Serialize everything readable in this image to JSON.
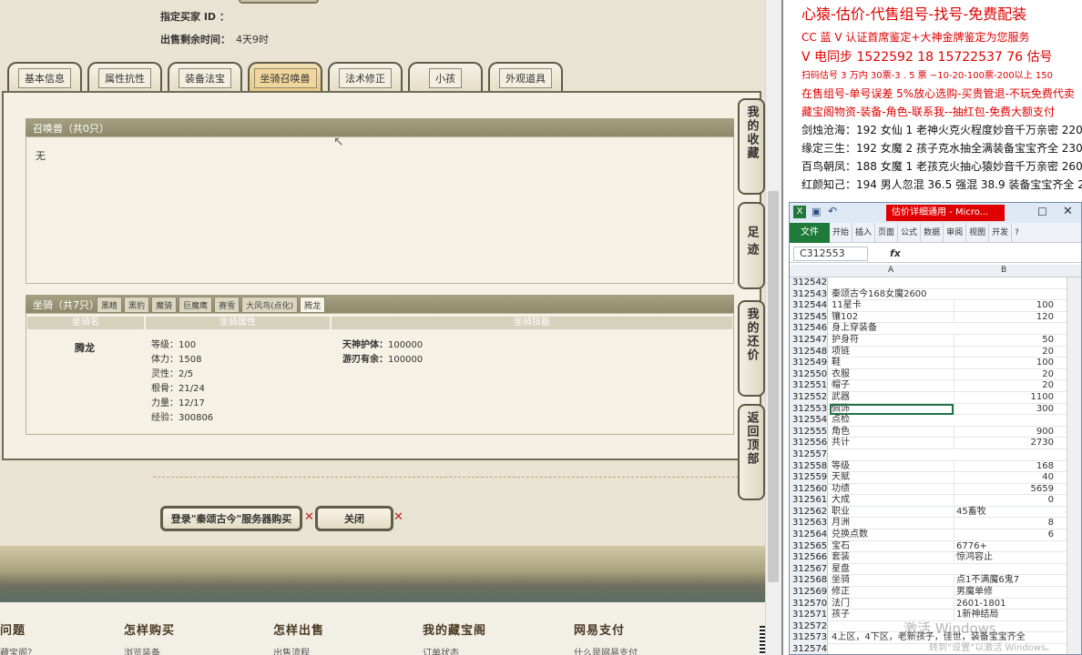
{
  "game": {
    "buyer_label": "指定买家 ID ：",
    "time_label": "出售剩余时间：",
    "time_value": "4天9时",
    "tabs": [
      "基本信息",
      "属性抗性",
      "装备法宝",
      "坐骑召唤兽",
      "法术修正",
      "小孩",
      "外观道具"
    ],
    "active_tab": "坐骑召唤兽",
    "summon_header": "召唤兽（共0只）",
    "summon_empty": "无",
    "mount_header": "坐骑（共7只）",
    "mount_tabs": [
      "黑睛",
      "黑豹",
      "魔骑",
      "巨魔鹰",
      "赛雪",
      "大风鸟(点化)",
      "腾龙"
    ],
    "mount_cols": [
      "坐骑名",
      "坐骑属性",
      "坐骑技能"
    ],
    "mount_name": "腾龙",
    "mount_attrs": [
      "等级：100",
      "体力：1508",
      "灵性：2/5",
      "根骨：21/24",
      "力量：12/17",
      "经验：300806"
    ],
    "mount_skills": [
      {
        "name": "天神护体：",
        "value": "100000"
      },
      {
        "name": "游刃有余：",
        "value": "100000"
      }
    ],
    "side_buttons": [
      "我的收藏",
      "足迹",
      "我的还价",
      "返回顶部"
    ],
    "login_button": "登录\"秦颂古今\"服务器购买",
    "close_button": "关闭",
    "footer": [
      {
        "title": "问题",
        "link": "藏宝阁？"
      },
      {
        "title": "怎样购买",
        "link": "浏览装备"
      },
      {
        "title": "怎样出售",
        "link": "出售流程"
      },
      {
        "title": "我的藏宝阁",
        "link": "订单状态"
      },
      {
        "title": "网易支付",
        "link": "什么是网易支付"
      }
    ]
  },
  "notes": {
    "lines": [
      {
        "text": "心猿-估价-代售组号-找号-免费配装",
        "style": "red big"
      },
      {
        "text": "CC 蓝 V 认证首席鉴定+大神金牌鉴定为您服务",
        "style": "red"
      },
      {
        "text": "V 电同步 1522592 18 15722537 76 估号",
        "style": "red big"
      },
      {
        "text": "扫码估号 3 万内 30票-3 . 5 票 ~10-20-100票-200以上 150",
        "style": "red"
      },
      {
        "text": "在售组号-单号误差 5%放心选购-买贵管退-不玩免费代卖",
        "style": "red"
      },
      {
        "text": "藏宝阁物资-装备-角色-联系我--抽红包-免费大额支付",
        "style": "red"
      },
      {
        "text": "剑烛沧海：192 女仙 1 老神火克火程度妙音千万亲密 22000",
        "style": "black"
      },
      {
        "text": "缘定三生：192 女魔 2 孩子克水抽全满装备宝宝齐全 23000",
        "style": "black"
      },
      {
        "text": "百鸟朝凤：188 女魔 1 老孩克火抽心猿妙音千万亲密 26000",
        "style": "black"
      },
      {
        "text": "红颜知己：194 男人忽混 36.5 强混 38.9 装备宝宝齐全 27500",
        "style": "black"
      }
    ]
  },
  "excel": {
    "title": "估价详细通用 - Micro...",
    "file_tab": "文件",
    "ribbon_tabs": [
      "开始",
      "插入",
      "页面",
      "公式",
      "数据",
      "审阅",
      "视图",
      "开发"
    ],
    "name_box": "C312553",
    "fx": "fx",
    "col_a": "A",
    "col_b": "B",
    "rows": [
      {
        "n": "312542",
        "a": "",
        "b": ""
      },
      {
        "n": "312543",
        "a": "秦颂古今168女魔2600",
        "b": ""
      },
      {
        "n": "312544",
        "a": "11星卡",
        "b": "100",
        "num": true
      },
      {
        "n": "312545",
        "a": "镶102",
        "b": "120",
        "num": true
      },
      {
        "n": "312546",
        "a": "身上穿装备",
        "b": ""
      },
      {
        "n": "312547",
        "a": "护身符",
        "b": "50",
        "num": true
      },
      {
        "n": "312548",
        "a": "项链",
        "b": "20",
        "num": true
      },
      {
        "n": "312549",
        "a": "鞋",
        "b": "100",
        "num": true
      },
      {
        "n": "312550",
        "a": "衣服",
        "b": "20",
        "num": true
      },
      {
        "n": "312551",
        "a": "帽子",
        "b": "20",
        "num": true
      },
      {
        "n": "312552",
        "a": "武器",
        "b": "1100",
        "num": true
      },
      {
        "n": "312553",
        "a": "佩饰",
        "b": "300",
        "num": true
      },
      {
        "n": "312554",
        "a": "点检",
        "b": ""
      },
      {
        "n": "312555",
        "a": "角色",
        "b": "900",
        "num": true
      },
      {
        "n": "312556",
        "a": "共计",
        "b": "2730",
        "num": true
      },
      {
        "n": "312557",
        "a": "",
        "b": ""
      },
      {
        "n": "312558",
        "a": "等级",
        "b": "168",
        "num": true
      },
      {
        "n": "312559",
        "a": "天赋",
        "b": "40",
        "num": true
      },
      {
        "n": "312560",
        "a": "功绩",
        "b": "5659",
        "num": true
      },
      {
        "n": "312561",
        "a": "大成",
        "b": "0",
        "num": true
      },
      {
        "n": "312562",
        "a": "职业",
        "b": "45畜牧"
      },
      {
        "n": "312563",
        "a": "月洲",
        "b": "8",
        "num": true
      },
      {
        "n": "312564",
        "a": "兑换点数",
        "b": "6",
        "num": true
      },
      {
        "n": "312565",
        "a": "宝石",
        "b": "6776+"
      },
      {
        "n": "312566",
        "a": "套装",
        "b": "惊鸿容止"
      },
      {
        "n": "312567",
        "a": "星盘",
        "b": ""
      },
      {
        "n": "312568",
        "a": "坐骑",
        "b": "点1不满魔6鬼7"
      },
      {
        "n": "312569",
        "a": "修正",
        "b": "男魔单修"
      },
      {
        "n": "312570",
        "a": "法门",
        "b": "2601-1801"
      },
      {
        "n": "312571",
        "a": "孩子",
        "b": "1新神结局"
      },
      {
        "n": "312572",
        "a": "",
        "b": ""
      },
      {
        "n": "312573",
        "a": "4上区，4下区，老新孩子，佳世，装备宝宝齐全",
        "b": ""
      },
      {
        "n": "312574",
        "a": "",
        "b": ""
      }
    ]
  },
  "watermark": {
    "line1": "激活 Windows",
    "line2": "转到“设置”以激活 Windows。"
  }
}
